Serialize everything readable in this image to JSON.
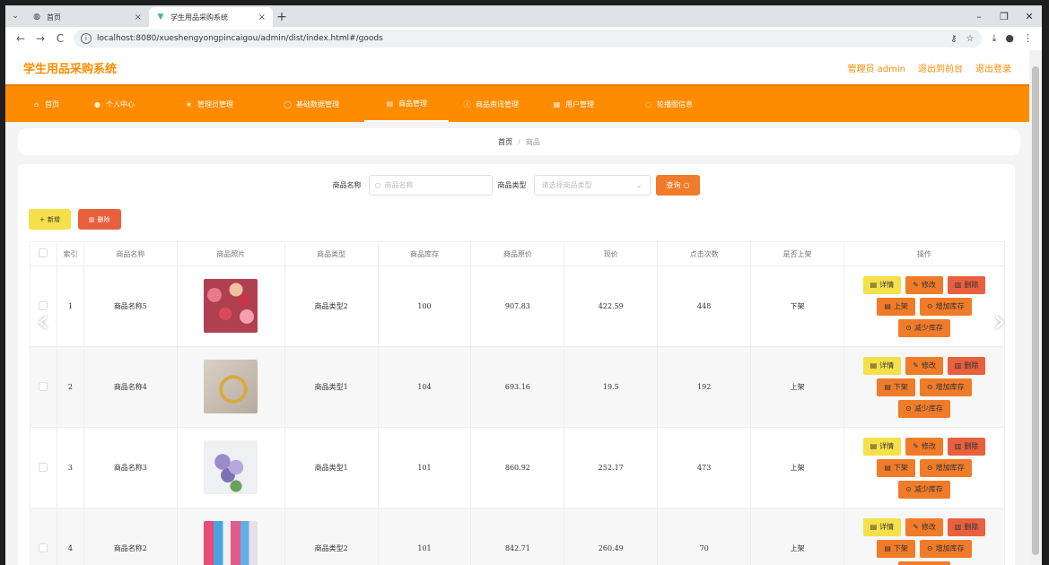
{
  "browser": {
    "tabs": [
      {
        "title": "首页",
        "icon": "globe-icon"
      },
      {
        "title": "学生用品采购系统",
        "icon": "vue-icon"
      }
    ],
    "url": "localhost:8080/xueshengyongpincaigou/admin/dist/index.html#/goods"
  },
  "header": {
    "title": "学生用品采购系统",
    "admin_label": "管理员 admin",
    "front_link": "退出到前台",
    "logout_link": "退出登录"
  },
  "menu": [
    {
      "label": "首页",
      "icon": "home-icon"
    },
    {
      "label": "个人中心",
      "icon": "user-icon"
    },
    {
      "label": "管理员管理",
      "icon": "star-icon"
    },
    {
      "label": "基础数据管理",
      "icon": "circle-icon"
    },
    {
      "label": "商品管理",
      "icon": "grid-icon",
      "active": true
    },
    {
      "label": "商品资讯管理",
      "icon": "info-icon"
    },
    {
      "label": "用户管理",
      "icon": "users-icon"
    },
    {
      "label": "轮播图信息",
      "icon": "image-icon"
    }
  ],
  "breadcrumb": {
    "home": "首页",
    "current": "商品"
  },
  "search": {
    "name_label": "商品名称",
    "name_placeholder": "商品名称",
    "type_label": "商品类型",
    "type_placeholder": "请选择商品类型",
    "query_button": "查询"
  },
  "actions": {
    "add": "新增",
    "delete": "删除"
  },
  "table": {
    "headers": [
      "索引",
      "商品名称",
      "商品照片",
      "商品类型",
      "商品库存",
      "商品原价",
      "现价",
      "点击次数",
      "是否上架",
      "操作"
    ],
    "rows": [
      {
        "index": "1",
        "name": "商品名称5",
        "type": "商品类型2",
        "stock": "100",
        "orig": "907.83",
        "price": "422.59",
        "clicks": "448",
        "status": "下架",
        "shelf_btn": "上架",
        "img": "img1"
      },
      {
        "index": "2",
        "name": "商品名称4",
        "type": "商品类型1",
        "stock": "104",
        "orig": "693.16",
        "price": "19.5",
        "clicks": "192",
        "status": "上架",
        "shelf_btn": "下架",
        "img": "img2"
      },
      {
        "index": "3",
        "name": "商品名称3",
        "type": "商品类型1",
        "stock": "101",
        "orig": "860.92",
        "price": "252.17",
        "clicks": "473",
        "status": "上架",
        "shelf_btn": "下架",
        "img": "img3"
      },
      {
        "index": "4",
        "name": "商品名称2",
        "type": "商品类型2",
        "stock": "101",
        "orig": "842.71",
        "price": "260.49",
        "clicks": "70",
        "status": "上架",
        "shelf_btn": "下架",
        "img": "img4"
      }
    ],
    "op_labels": {
      "detail": "详情",
      "edit": "修改",
      "delete": "删除",
      "add_stock": "增加库存",
      "reduce_stock": "减少库存"
    }
  },
  "colors": {
    "accent": "#ff8c00",
    "yellow": "#f5e04a",
    "red": "#e9603e",
    "orange": "#f07c2a"
  }
}
